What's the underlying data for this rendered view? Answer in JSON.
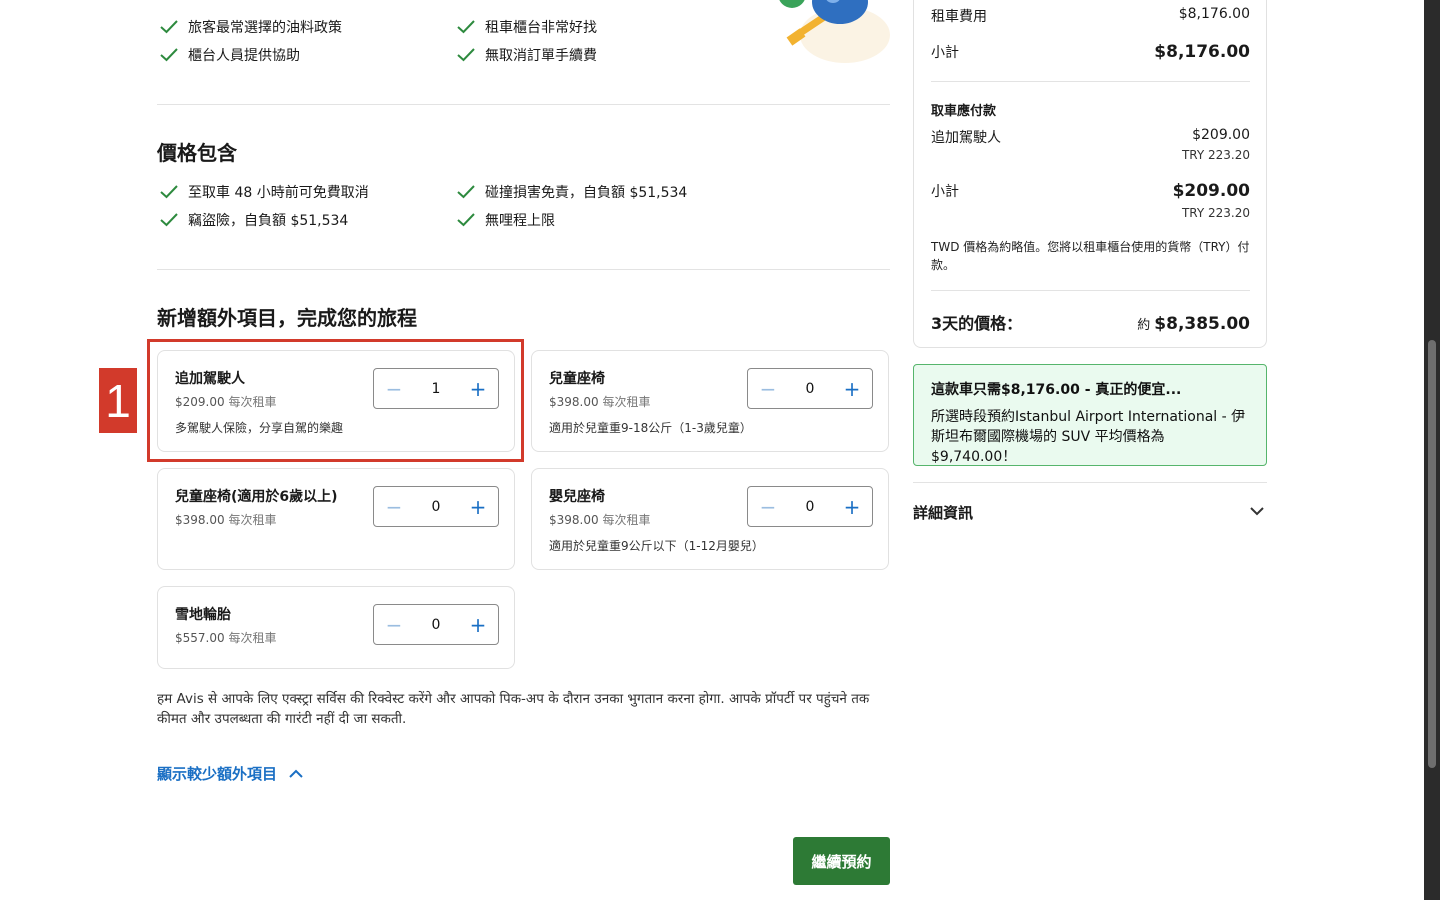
{
  "top_features": {
    "left": [
      "旅客最常選擇的油料政策",
      "櫃台人員提供協助"
    ],
    "right": [
      "租車櫃台非常好找",
      "無取消訂單手續費"
    ]
  },
  "included": {
    "title": "價格包含",
    "left": [
      "至取車 48 小時前可免費取消",
      "竊盜險，自負額 $51,534"
    ],
    "right": [
      "碰撞損害免責，自負額 $51,534",
      "無哩程上限"
    ]
  },
  "extras": {
    "title": "新增額外項目，完成您的旅程",
    "per_rental": "每次租車",
    "items": [
      {
        "name": "追加駕駛人",
        "price": "$209.00",
        "desc": "多駕駛人保險，分享自駕的樂趣",
        "qty": "1"
      },
      {
        "name": "兒童座椅",
        "price": "$398.00",
        "desc": "適用於兒童重9-18公斤（1-3歲兒童）",
        "qty": "0"
      },
      {
        "name": "兒童座椅(適用於6歲以上)",
        "price": "$398.00",
        "desc": "",
        "qty": "0"
      },
      {
        "name": "嬰兒座椅",
        "price": "$398.00",
        "desc": "適用於兒童重9公斤以下（1-12月嬰兒）",
        "qty": "0"
      },
      {
        "name": "雪地輪胎",
        "price": "$557.00",
        "desc": "",
        "qty": "0"
      }
    ],
    "step_label": "1",
    "note": "हम Avis से आपके लिए एक्स्ट्रा सर्विस की रिक्वेस्ट करेंगे और आपको पिक-अप के दौरान उनका भुगतान करना होगा. आपके प्रॉपर्टी पर पहुंचने तक कीमत और उपलब्धता की गारंटी नहीं दी जा सकती.",
    "show_less": "顯示較少額外項目",
    "continue": "繼續預約"
  },
  "summary": {
    "rental_fee_label": "租車費用",
    "rental_fee": "$8,176.00",
    "subtotal_label": "小計",
    "subtotal": "$8,176.00",
    "pickup_heading": "取車應付款",
    "extra_driver_label": "追加駕駛人",
    "extra_driver_price": "$209.00",
    "extra_driver_try": "TRY 223.20",
    "subtotal2_label": "小計",
    "subtotal2": "$209.00",
    "subtotal2_try": "TRY 223.20",
    "currency_note": "TWD 價格為約略值。您將以租車櫃台使用的貨幣（TRY）付款。",
    "total_label": "3天的價格：",
    "total_approx": "約",
    "total": "$8,385.00"
  },
  "deal": {
    "title": "這款車只需$8,176.00 - 真正的便宜...",
    "body": "所選時段預約Istanbul Airport International - 伊斯坦布爾國際機場的 SUV 平均價格為 $9,740.00！"
  },
  "details": {
    "label": "詳細資訊"
  },
  "colors": {
    "accent": "#1a6fc4",
    "check": "#2d8a3e",
    "highlight": "#d23a2b",
    "cta": "#2d7a35",
    "deal_bg": "#eafaef"
  }
}
